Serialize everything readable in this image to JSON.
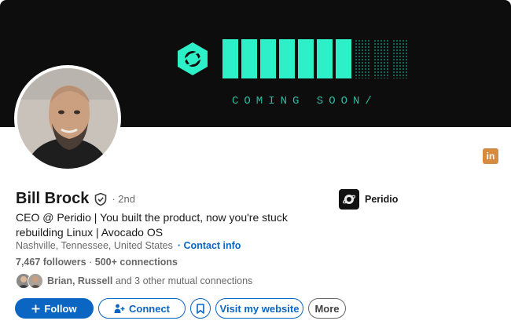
{
  "banner": {
    "coming_soon": "COMING SOON/",
    "accent_color": "#2ef0c8",
    "bars_lit": 7,
    "bars_total": 10
  },
  "profile": {
    "name": "Bill Brock",
    "degree": "· 2nd",
    "headline": "CEO @ Peridio | You built the product, now you're stuck rebuilding Linux | Avocado OS",
    "location": "Nashville, Tennessee, United States",
    "contact_info": "· Contact info",
    "followers": "7,467 followers",
    "connections": "500+ connections",
    "mutual": {
      "names": "Brian, Russell",
      "rest": " and 3 other mutual connections"
    }
  },
  "company": {
    "name": "Peridio"
  },
  "badge": {
    "linkedin": "in"
  },
  "actions": {
    "follow": "Follow",
    "connect": "Connect",
    "visit_website": "Visit my website",
    "more": "More"
  },
  "colors": {
    "link_blue": "#0a66c2",
    "linkedin_badge": "#d68c40"
  }
}
